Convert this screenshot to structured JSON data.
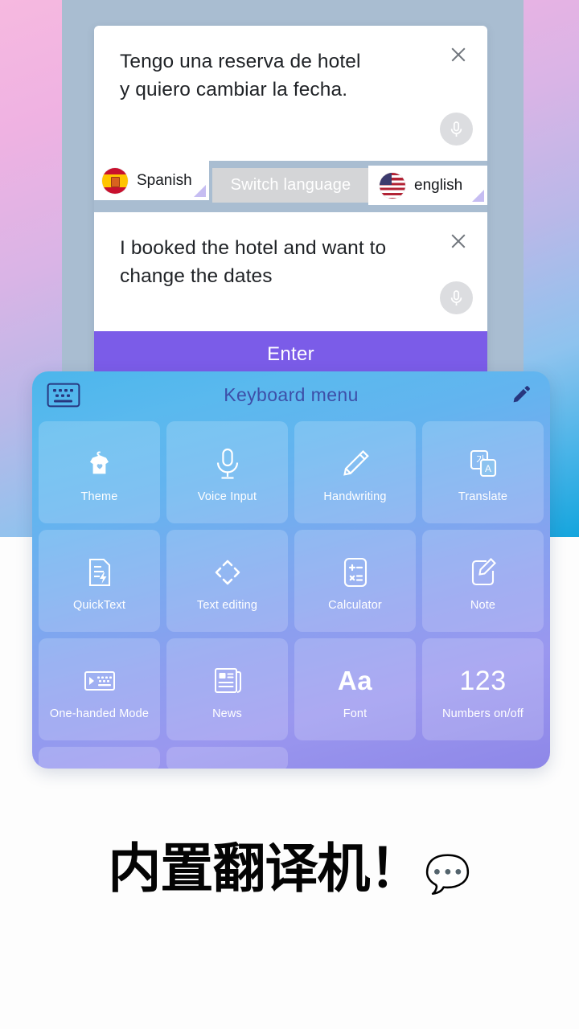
{
  "background": {
    "gradient_from": "#f6b9e0",
    "gradient_to": "#14a5dd",
    "panel_color": "#a9bdd1"
  },
  "translator": {
    "source": {
      "text": "Tengo una reserva de hotel\ny quiero cambiar la fecha.",
      "close_icon": "close-icon",
      "mic_icon": "microphone-icon"
    },
    "target": {
      "text": "I booked the hotel and want to\nchange the dates",
      "close_icon": "close-icon",
      "mic_icon": "microphone-icon"
    },
    "source_language": {
      "label": "Spanish",
      "flag": "spain-flag-icon"
    },
    "target_language": {
      "label": "english",
      "flag": "usa-flag-icon"
    },
    "switch_button": {
      "label": "Switch language",
      "background": "#d4d5d7"
    },
    "enter_button": {
      "label": "Enter",
      "background": "#7b5ce8"
    }
  },
  "keyboard_menu": {
    "title": "Keyboard menu",
    "title_color": "#3d4fa8",
    "left_icon": "keyboard-icon",
    "right_icon": "pencil-edit-icon",
    "tiles": [
      {
        "label": "Theme",
        "icon": "tshirt-heart-icon"
      },
      {
        "label": "Voice Input",
        "icon": "microphone-icon"
      },
      {
        "label": "Handwriting",
        "icon": "pencil-icon"
      },
      {
        "label": "Translate",
        "icon": "translate-cards-icon"
      },
      {
        "label": "QuickText",
        "icon": "document-bolt-icon"
      },
      {
        "label": "Text editing",
        "icon": "four-way-arrows-icon"
      },
      {
        "label": "Calculator",
        "icon": "calculator-icon"
      },
      {
        "label": "Note",
        "icon": "note-pencil-icon"
      },
      {
        "label": "One-handed Mode",
        "icon": "one-handed-keyboard-icon"
      },
      {
        "label": "News",
        "icon": "newspaper-icon"
      },
      {
        "label": "Font",
        "icon": "Aa"
      },
      {
        "label": "Numbers on/off",
        "icon": "123"
      }
    ]
  },
  "headline": {
    "text": "内置翻译机！",
    "emoji": "💬"
  }
}
